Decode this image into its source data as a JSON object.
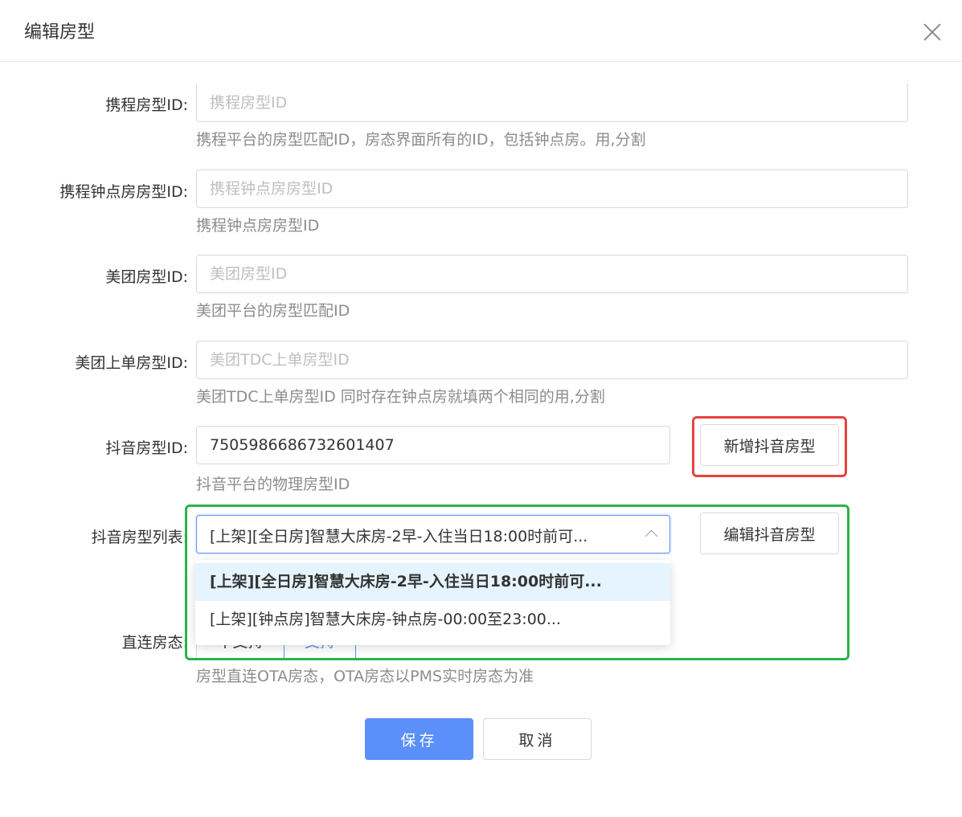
{
  "dialog": {
    "title": "编辑房型",
    "close_icon": "close-icon"
  },
  "fields": {
    "ctrip_room_id": {
      "label": "携程房型ID:",
      "placeholder": "携程房型ID",
      "help": "携程平台的房型匹配ID，房态界面所有的ID，包括钟点房。用,分割"
    },
    "ctrip_hourly_room_id": {
      "label": "携程钟点房房型ID:",
      "placeholder": "携程钟点房房型ID",
      "help": "携程钟点房房型ID"
    },
    "meituan_room_id": {
      "label": "美团房型ID:",
      "placeholder": "美团房型ID",
      "help": "美团平台的房型匹配ID"
    },
    "meituan_order_room_id": {
      "label": "美团上单房型ID:",
      "placeholder": "美团TDC上单房型ID",
      "help": "美团TDC上单房型ID 同时存在钟点房就填两个相同的用,分割"
    },
    "douyin_room_id": {
      "label": "抖音房型ID:",
      "value": "7505986686732601407",
      "help": "抖音平台的物理房型ID",
      "add_button": "新增抖音房型"
    },
    "douyin_room_list": {
      "label": "抖音房型列表:",
      "selected": "[上架][全日房]智慧大床房-2早-入住当日18:00时前可...",
      "edit_button": "编辑抖音房型",
      "options": [
        "[上架][全日房]智慧大床房-2早-入住当日18:00时前可...",
        "[上架][钟点房]智慧大床房-钟点房-00:00至23:00..."
      ],
      "chevron_icon": "chevron-up-icon"
    },
    "direct_status": {
      "label": "直连房态:",
      "options": [
        "不支持",
        "支持"
      ],
      "selected": "支持",
      "help": "房型直连OTA房态，OTA房态以PMS实时房态为准"
    }
  },
  "actions": {
    "save": "保存",
    "cancel": "取消"
  },
  "colors": {
    "primary": "#5b8ff9",
    "highlight_red": "#e64340",
    "highlight_green": "#2bb34a",
    "option_selected_bg": "#e6f4ff"
  }
}
